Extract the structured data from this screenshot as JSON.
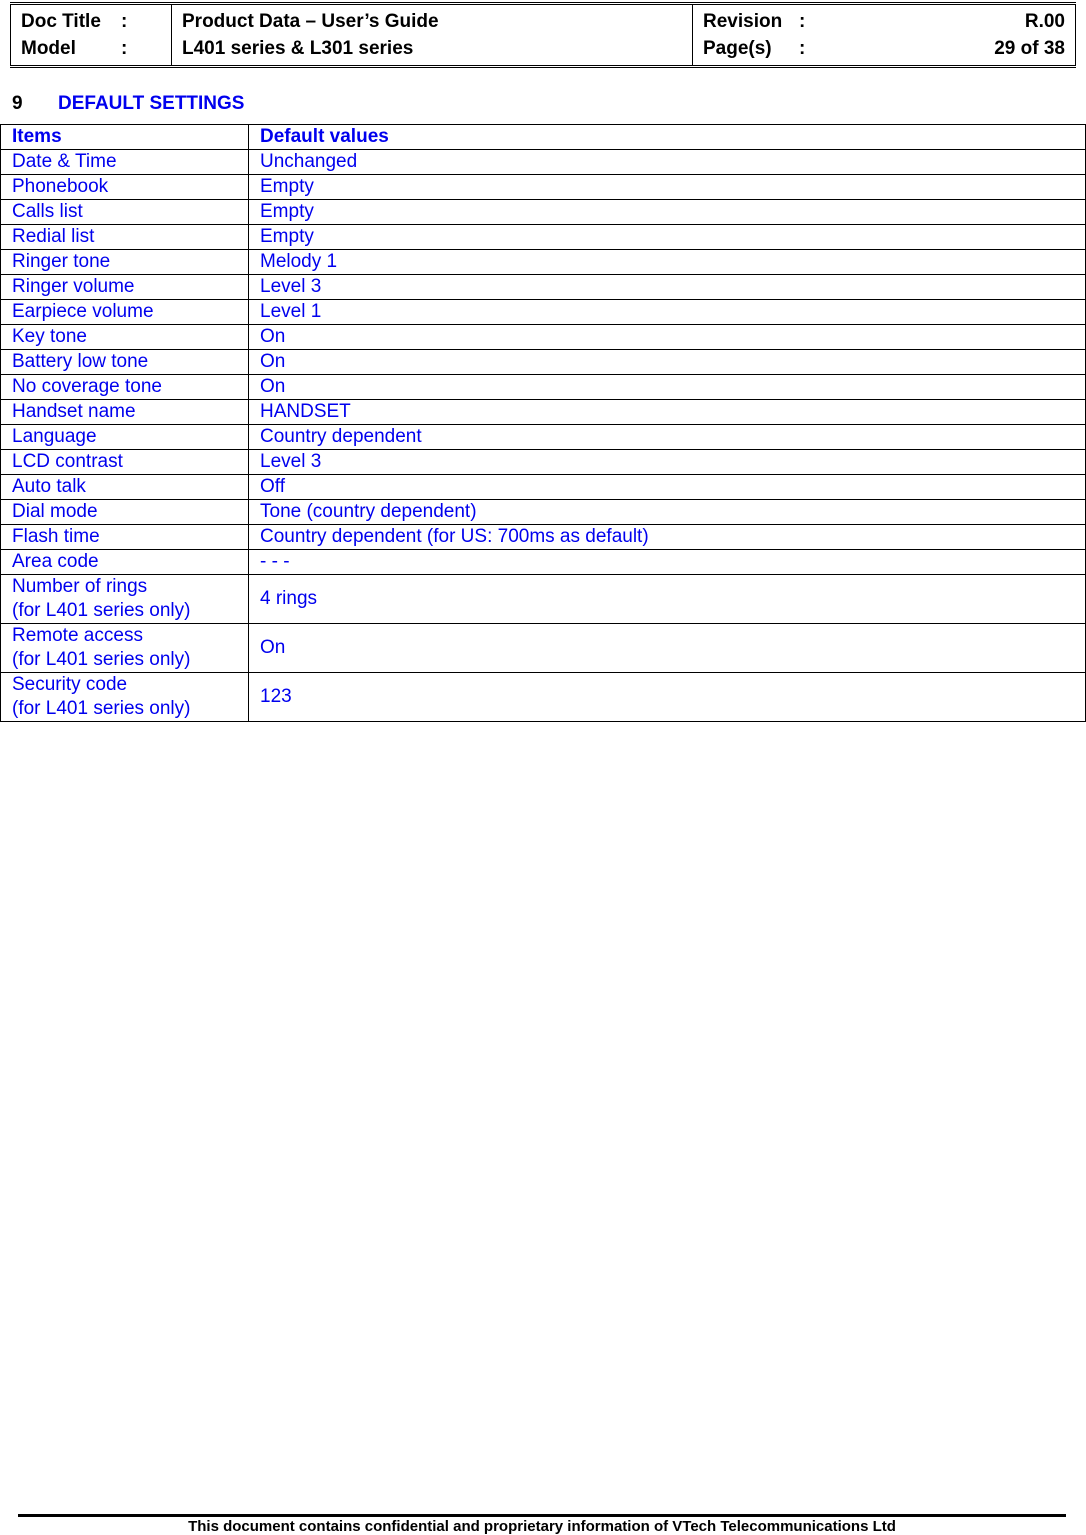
{
  "header": {
    "doc_title_label": "Doc Title",
    "model_label": "Model",
    "colon": ":",
    "doc_title": "Product Data – User’s Guide",
    "model": "L401 series & L301 series",
    "revision_label": "Revision",
    "revision": "R.00",
    "pages_label": "Page(s)",
    "pages": "29 of 38"
  },
  "section": {
    "number": "9",
    "title": "DEFAULT SETTINGS"
  },
  "table": {
    "headers": [
      "Items",
      "Default values"
    ],
    "rows": [
      {
        "item": "Date & Time",
        "value": "Unchanged"
      },
      {
        "item": "Phonebook",
        "value": "Empty"
      },
      {
        "item": "Calls list",
        "value": "Empty"
      },
      {
        "item": "Redial list",
        "value": "Empty"
      },
      {
        "item": "Ringer tone",
        "value": "Melody 1"
      },
      {
        "item": "Ringer volume",
        "value": "Level 3"
      },
      {
        "item": "Earpiece volume",
        "value": "Level 1"
      },
      {
        "item": "Key tone",
        "value": "On"
      },
      {
        "item": "Battery low tone",
        "value": "On"
      },
      {
        "item": "No coverage tone",
        "value": "On"
      },
      {
        "item": "Handset name",
        "value": "HANDSET"
      },
      {
        "item": "Language",
        "value": "Country dependent"
      },
      {
        "item": "LCD contrast",
        "value": "Level 3"
      },
      {
        "item": "Auto talk",
        "value": "Off"
      },
      {
        "item": "Dial mode",
        "value": "Tone (country dependent)"
      },
      {
        "item": "Flash time",
        "value": "Country dependent (for US: 700ms as default)"
      },
      {
        "item": "Area code",
        "value": "- - -"
      },
      {
        "item": "Number of rings",
        "note": "(for L401 series only)",
        "value": "4 rings"
      },
      {
        "item": "Remote access",
        "note": "(for L401 series only)",
        "value": "On"
      },
      {
        "item": "Security code",
        "note": "(for L401 series only)",
        "value": "123"
      }
    ]
  },
  "footer": {
    "text": "This document contains confidential and proprietary information of VTech Telecommunications Ltd"
  }
}
